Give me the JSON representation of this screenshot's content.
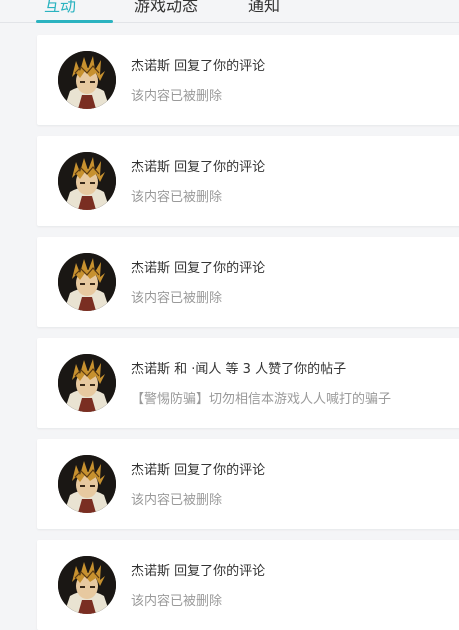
{
  "tabs": [
    {
      "label": "互动",
      "active": true
    },
    {
      "label": "游戏动态",
      "active": false
    },
    {
      "label": "通知",
      "active": false
    }
  ],
  "colors": {
    "accent": "#2bb3c0",
    "background": "#f4f5f7",
    "card": "#ffffff",
    "muted": "#9a9a9a"
  },
  "notifications": [
    {
      "avatar_icon": "user-avatar-icon",
      "title": "杰诺斯 回复了你的评论",
      "subtitle": "该内容已被删除"
    },
    {
      "avatar_icon": "user-avatar-icon",
      "title": "杰诺斯 回复了你的评论",
      "subtitle": "该内容已被删除"
    },
    {
      "avatar_icon": "user-avatar-icon",
      "title": "杰诺斯 回复了你的评论",
      "subtitle": "该内容已被删除"
    },
    {
      "avatar_icon": "user-avatar-icon",
      "title": "杰诺斯 和 ·闻人 等 3 人赞了你的帖子",
      "subtitle": "【警惕防骗】切勿相信本游戏人人喊打的骗子"
    },
    {
      "avatar_icon": "user-avatar-icon",
      "title": "杰诺斯 回复了你的评论",
      "subtitle": "该内容已被删除"
    },
    {
      "avatar_icon": "user-avatar-icon",
      "title": "杰诺斯 回复了你的评论",
      "subtitle": "该内容已被删除"
    }
  ]
}
